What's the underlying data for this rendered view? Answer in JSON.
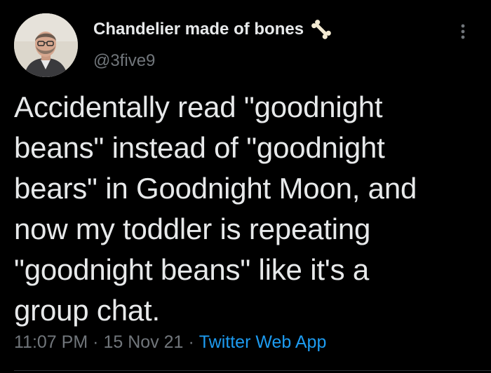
{
  "author": {
    "display_name": "Chandelier made of bones",
    "handle": "@3five9",
    "avatar_icon": "user-avatar-photo",
    "emoji_icon": "bone-icon"
  },
  "tweet": {
    "text": "Accidentally read \"goodnight\nbeans\" instead of \"goodnight\nbears\" in Goodnight Moon, and\nnow my toddler is repeating\n\"goodnight beans\" like it's a\ngroup chat.",
    "time": "11:07 PM",
    "date": "15 Nov 21",
    "separator": "·",
    "source": "Twitter Web App"
  },
  "menu": {
    "icon": "more-options-icon"
  },
  "colors": {
    "background": "#000000",
    "primary_text": "#e7e9ea",
    "secondary_text": "#71767b",
    "link": "#1d9bf0"
  }
}
